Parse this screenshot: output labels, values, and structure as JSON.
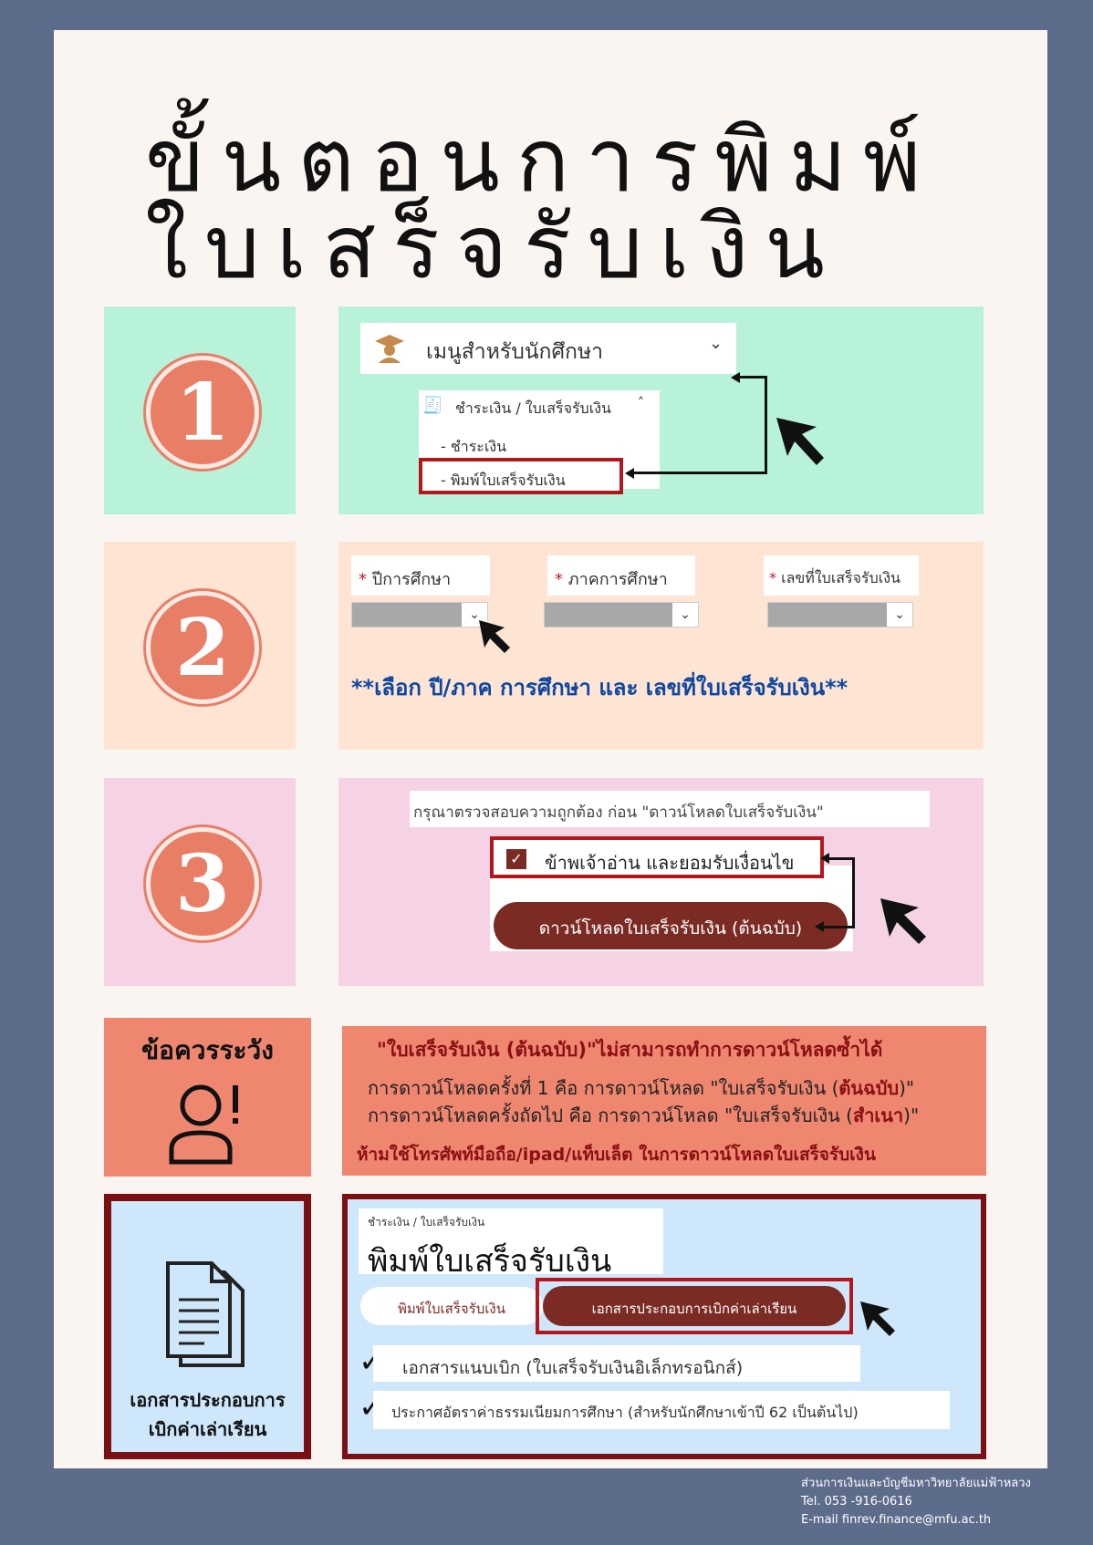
{
  "title_line1": "ขั้นตอนการพิมพ์",
  "title_line2": "ใบเสร็จรับเงิน",
  "step1": {
    "number": "1",
    "menu_label": "เมนูสำหรับนักศึกษา",
    "submenu_label": "ชำระเงิน / ใบเสร็จรับเงิน",
    "item_pay": "- ชำระเงิน",
    "item_print": "- พิมพ์ใบเสร็จรับเงิน"
  },
  "step2": {
    "number": "2",
    "field_year": "ปีการศึกษา",
    "field_term": "ภาคการศึกษา",
    "field_receipt": "เลขที่ใบเสร็จรับเงิน",
    "instruction": "**เลือก ปี/ภาค การศึกษา และ เลขที่ใบเสร็จรับเงิน**"
  },
  "step3": {
    "number": "3",
    "notice": "กรุณาตรวจสอบความถูกต้อง ก่อน \"ดาวน์โหลดใบเสร็จรับเงิน\"",
    "checkbox_label": "ข้าพเจ้าอ่าน และยอมรับเงื่อนไข",
    "download_button": "ดาวน์โหลดใบเสร็จรับเงิน (ต้นฉบับ)"
  },
  "caution": {
    "title": "ข้อควรระวัง",
    "line1": "\"ใบเสร็จรับเงิน (ต้นฉบับ)\"ไม่สามารถทำการดาวน์โหลดซ้ำได้",
    "line2a": "การดาวน์โหลดครั้งที่ 1 คือ การดาวน์โหลด \"ใบเสร็จรับเงิน (",
    "line2b": "ต้นฉบับ",
    "line2c": ")\"",
    "line3a": "การดาวน์โหลดครั้งถัดไป คือ การดาวน์โหลด \"ใบเสร็จรับเงิน (",
    "line3b": "สำเนา",
    "line3c": ")\"",
    "line4": "ห้ามใช้โทรศัพท์มือถือ/ipad/แท็บเล็ต ในการดาวน์โหลดใบเสร็จรับเงิน"
  },
  "docs": {
    "title_line1": "เอกสารประกอบการ",
    "title_line2": "เบิกค่าเล่าเรียน",
    "breadcrumb": "ชำระเงิน / ใบเสร็จรับเงิน",
    "page_heading": "พิมพ์ใบเสร็จรับเงิน",
    "tab1": "พิมพ์ใบเสร็จรับเงิน",
    "tab2": "เอกสารประกอบการเบิกค่าเล่าเรียน",
    "item1": "เอกสารแนบเบิก (ใบเสร็จรับเงินอิเล็กทรอนิกส์)",
    "item2": "ประกาศอัตราค่าธรรมเนียมการศึกษา (สำหรับนักศึกษาเข้าปี 62 เป็นต้นไป)"
  },
  "footer": {
    "org": "ส่วนการเงินและบัญชีมหาวิทยาลัยแม่ฟ้าหลวง",
    "tel": "Tel. 053 -916-0616",
    "email": "E-mail  finrev.finance@mfu.ac.th"
  },
  "colors": {
    "background": "#5e6c8c",
    "step1": "#b8f2d9",
    "step2": "#fde4d3",
    "step3": "#f5d3e5",
    "caution": "#ef8670",
    "docs": "#cfe7fb",
    "accent_red": "#b3161d",
    "button_brown": "#7b2b24"
  }
}
